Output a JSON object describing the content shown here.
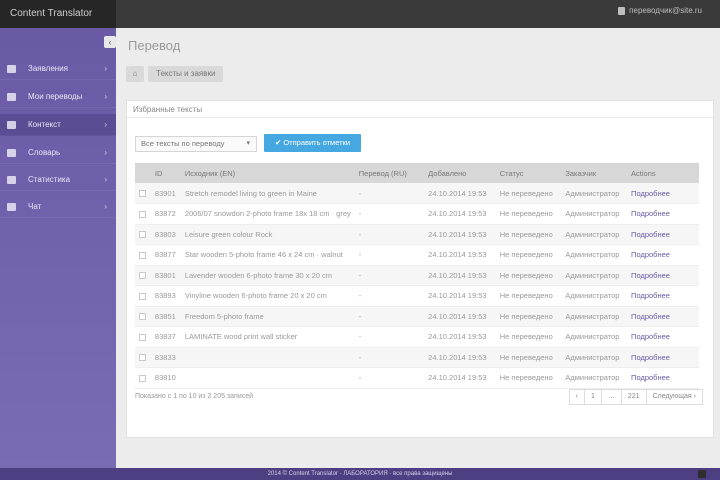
{
  "app": {
    "brand": "Content Translator",
    "user": "переводчик@site.ru"
  },
  "sidebar": {
    "collapse_glyph": "‹",
    "items": [
      {
        "label": "Заявления",
        "icon": "home-icon",
        "active": false
      },
      {
        "label": "Мои переводы",
        "icon": "edit-icon",
        "active": false
      },
      {
        "label": "Контекст",
        "icon": "list-icon",
        "active": true
      },
      {
        "label": "Словарь",
        "icon": "book-icon",
        "active": false
      },
      {
        "label": "Статистика",
        "icon": "chart-icon",
        "active": false
      },
      {
        "label": "Чат",
        "icon": "chat-icon",
        "active": false
      }
    ]
  },
  "page": {
    "title": "Перевод",
    "breadcrumb": {
      "home": "⌂",
      "current": "Тексты и заявки"
    }
  },
  "panel": {
    "title": "Избранные тексты",
    "select": {
      "value": "Все тексты по переводу"
    },
    "send_button": "Отправить отметки"
  },
  "table": {
    "headers": [
      "",
      "ID",
      "Исходник (EN)",
      "Перевод (RU)",
      "Добавлено",
      "Статус",
      "Заказчик",
      "Actions"
    ],
    "rows": [
      {
        "id": "83901",
        "source": "Stretch remodel living to green in Maine",
        "target": "-",
        "date": "24.10.2014 19:53",
        "status": "Не переведено",
        "client": "Администратор",
        "action": "Подробнее"
      },
      {
        "id": "83872",
        "source": "2006/07 snowdon 2-photo frame 18x 18 cm · grey",
        "target": "-",
        "date": "24.10.2014 19:53",
        "status": "Не переведено",
        "client": "Администратор",
        "action": "Подробнее"
      },
      {
        "id": "83803",
        "source": "Leisure green colour Rock",
        "target": "-",
        "date": "24.10.2014 19:53",
        "status": "Не переведено",
        "client": "Администратор",
        "action": "Подробнее"
      },
      {
        "id": "83877",
        "source": "Star wooden 5-photo frame 46 x 24 cm · walnut",
        "target": "-",
        "date": "24.10.2014 19:53",
        "status": "Не переведено",
        "client": "Администратор",
        "action": "Подробнее"
      },
      {
        "id": "83801",
        "source": "Lavender wooden 6-photo frame 30 x 20 cm",
        "target": "-",
        "date": "24.10.2014 19:53",
        "status": "Не переведено",
        "client": "Администратор",
        "action": "Подробнее"
      },
      {
        "id": "83893",
        "source": "Vinyline wooden 6-photo frame 20 x 20 cm",
        "target": "-",
        "date": "24.10.2014 19:53",
        "status": "Не переведено",
        "client": "Администратор",
        "action": "Подробнее"
      },
      {
        "id": "83851",
        "source": "Freedom 5-photo frame",
        "target": "-",
        "date": "24.10.2014 19:53",
        "status": "Не переведено",
        "client": "Администратор",
        "action": "Подробнее"
      },
      {
        "id": "83837",
        "source": "LAMINATE wood print wall sticker",
        "target": "-",
        "date": "24.10.2014 19:53",
        "status": "Не переведено",
        "client": "Администратор",
        "action": "Подробнее"
      },
      {
        "id": "83833",
        "source": "",
        "target": "-",
        "date": "24.10.2014 19:53",
        "status": "Не переведено",
        "client": "Администратор",
        "action": "Подробнее"
      },
      {
        "id": "83810",
        "source": "",
        "target": "-",
        "date": "24.10.2014 19:53",
        "status": "Не переведено",
        "client": "Администратор",
        "action": "Подробнее"
      }
    ]
  },
  "pagination": {
    "info": "Показано с 1 по 10 из 2 205 записей",
    "pages": [
      "‹",
      "1",
      "…",
      "221",
      "Следующая ›"
    ]
  },
  "footer": {
    "text": "2014 © Content Translator · ЛАБОРАТОРИЯ · все права защищены"
  }
}
